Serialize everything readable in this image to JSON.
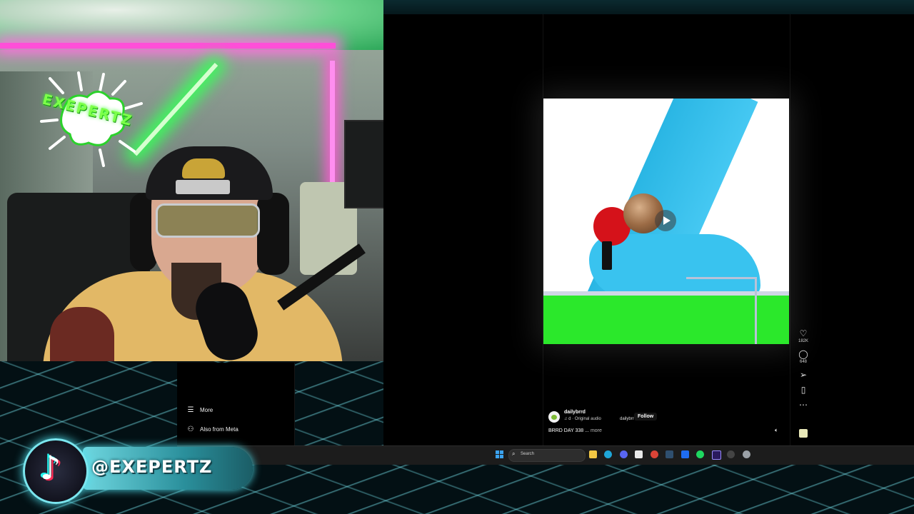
{
  "webcam": {
    "logo_text": "EXEPERTZ"
  },
  "sidebar": {
    "items": [
      {
        "label": "More",
        "icon": "menu-icon"
      },
      {
        "label": "Also from Meta",
        "icon": "meta-apps-icon"
      }
    ]
  },
  "post": {
    "author": "dailybrrd",
    "audio": "♫ d · Original audio",
    "audio_mini": "dailybrr",
    "follow_label": "Follow",
    "caption": "BRRD DAY 338 ...",
    "caption_more": "more",
    "actions": {
      "like_count": "182K",
      "comment_count": "648"
    }
  },
  "taskbar": {
    "search_placeholder": "Search",
    "apps": [
      "file-explorer-icon",
      "edge-icon",
      "discord-icon",
      "capcut-icon",
      "chrome-icon",
      "steam-icon",
      "dropbox-icon",
      "spotify-icon",
      "premiere-icon",
      "obs-icon",
      "settings-icon"
    ]
  },
  "overlay": {
    "handle": "@EXEPERTZ"
  },
  "colors": {
    "accent_cyan": "#4fe0ee",
    "tiktok_cyan": "#25f4ee",
    "tiktok_red": "#fe2c55",
    "video_table_green": "#2be82b",
    "video_ramp_blue": "#2ab6e4"
  }
}
